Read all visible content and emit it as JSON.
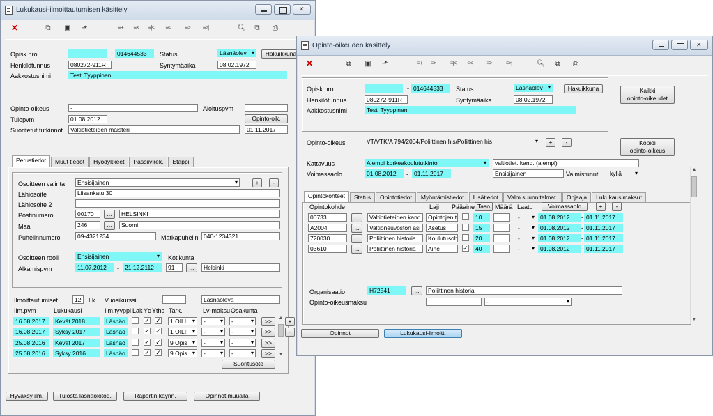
{
  "win1": {
    "title": "Lukukausi-ilmoittautumisen käsittely",
    "header": {
      "opiskno_label": "Opisk.nro",
      "opiskno_dash": "-",
      "opiskno_value": "014644533",
      "status_label": "Status",
      "status_value": "Läsnäolev",
      "hakuikkuna_button": "Hakuikkuna",
      "henkilotunnus_label": "Henkilötunnus",
      "henkilotunnus_value": "080272-911R",
      "syntymaaika_label": "Syntymäaika",
      "syntymaaika_value": "08.02.1972",
      "aakkostusnimi_label": "Aakkostusnimi",
      "aakkostusnimi_value": "Testi Tyyppinen"
    },
    "study": {
      "opinto_oikeus_label": "Opinto-oikeus",
      "opinto_oikeus_value": "-",
      "aloituspvm_label": "Aloituspvm",
      "tulopvm_label": "Tulopvm",
      "tulopvm_value": "01.08.2012",
      "opinto_oik_button": "Opinto-oik.",
      "suoritetut_label": "Suoritetut tutkinnot",
      "suoritetut_value": "Valtiotieteiden maisteri",
      "suoritetut_date": "01.11.2017"
    },
    "tabs": [
      "Perustiedot",
      "Muut tiedot",
      "Hyödykkeet",
      "Passiivirek.",
      "Etappi"
    ],
    "address": {
      "osoitteen_valinta_label": "Osoitteen valinta",
      "osoitteen_valinta_value": "Ensisijainen",
      "plus": "+",
      "minus": "-",
      "lahiosoite_label": "Lähiosoite",
      "lahiosoite_value": "Liisankatu 30",
      "lahiosoite2_label": "Lähiosoite 2",
      "postinumero_label": "Postinumero",
      "postinumero_value": "00170",
      "ellipsis": "...",
      "postitoimipaikka_value": "HELSINKI",
      "maa_label": "Maa",
      "maa_code": "246",
      "maa_name": "Suomi",
      "puhelin_label": "Puhelinnumero",
      "puhelin_value": "09-4321234",
      "matkapuhelin_label": "Matkapuhelin",
      "matkapuhelin_value": "040-1234321",
      "rooli_label": "Osoitteen rooli",
      "rooli_value": "Ensisijainen",
      "kotikunta_label": "Kotikunta",
      "alkamispvm_label": "Alkamispvm",
      "alkamis_from": "11.07.2012",
      "alkamis_dash": "-",
      "alkamis_to": "21.12.2112",
      "kotikunta_code": "91",
      "kotikunta_name": "Helsinki"
    },
    "ilmo": {
      "label": "Ilmoittautumiset",
      "count": "12",
      "lk": "Lk",
      "vuosikurssi_label": "Vuosikurssi",
      "status_text": "Läsnäoleva",
      "columns": [
        "Ilm.pvm",
        "Lukukausi",
        "Ilm.tyyppi",
        "Lak",
        "Yc",
        "Yths",
        "Tark.",
        "Lv-maksu",
        "Osakunta"
      ],
      "rows": [
        {
          "date": "16.08.2017",
          "term": "Kevät 2018",
          "type": "Läsnäo",
          "lak": false,
          "yc": true,
          "yths": true,
          "tark": "1 OILI:",
          "lv": "-",
          "osa": "-",
          "go": ">>"
        },
        {
          "date": "16.08.2017",
          "term": "Syksy 2017",
          "type": "Läsnäo",
          "lak": false,
          "yc": true,
          "yths": true,
          "tark": "1 OILI:",
          "lv": "-",
          "osa": "-",
          "go": ">>"
        },
        {
          "date": "25.08.2016",
          "term": "Kevät 2017",
          "type": "Läsnäo",
          "lak": false,
          "yc": true,
          "yths": true,
          "tark": "9 Opis",
          "lv": "-",
          "osa": "-",
          "go": ">>"
        },
        {
          "date": "25.08.2016",
          "term": "Syksy 2016",
          "type": "Läsnäo",
          "lak": false,
          "yc": true,
          "yths": true,
          "tark": "9 Opis",
          "lv": "-",
          "osa": "-",
          "go": ">>"
        }
      ],
      "suoritusote_button": "Suoritusote"
    },
    "bottom_buttons": [
      "Hyväksy ilm.",
      "Tulosta läsnäolotod.",
      "Raportin käynn.",
      "Opinnot muualla"
    ]
  },
  "win2": {
    "title": "Opinto-oikeuden käsittely",
    "header": {
      "opiskno_label": "Opisk.nro",
      "opiskno_dash": "-",
      "opiskno_value": "014644533",
      "status_label": "Status",
      "status_value": "Läsnäolev",
      "hakuikkuna_button": "Hakuikkuna",
      "henkilotunnus_label": "Henkilötunnus",
      "henkilotunnus_value": "080272-911R",
      "syntymaaika_label": "Syntymäaika",
      "syntymaaika_value": "08.02.1972",
      "aakkostusnimi_label": "Aakkostusnimi",
      "aakkostusnimi_value": "Testi Tyyppinen"
    },
    "kaikki_button_line1": "Kaikki",
    "kaikki_button_line2": "opinto-oikeudet",
    "kopioi_button_line1": "Kopioi",
    "kopioi_button_line2": "opinto-oikeus",
    "opinto_oikeus_label": "Opinto-oikeus",
    "opinto_oikeus_value": "VT/VTK/A 794/2004/Poliittinen his/Poliittinen his",
    "plus": "+",
    "minus": "-",
    "kattavuus_label": "Kattavuus",
    "kattavuus_value": "Alempi korkeakoulututkinto",
    "kattavuus_desc": "valtiotiet. kand. (alempi)",
    "voimassaolo_label": "Voimassaolo",
    "voimassa_from": "01.08.2012",
    "voimassa_dash": "-",
    "voimassa_to": "01.11.2017",
    "voimassa_type": "Ensisijainen",
    "valmistunut_label": "Valmistunut",
    "valmistunut_value": "kyllä",
    "tabs": [
      "Opintokohteet",
      "Status",
      "Opintotiedot",
      "Myöntämistiedot",
      "Lisätiedot",
      "Valm.suunnitelmat.",
      "Ohjaaja",
      "Lukukausimaksut"
    ],
    "columns": {
      "kohde": "Opintokohde",
      "laji": "Laji",
      "paaaine": "Pääaine",
      "taso": "Taso",
      "maara": "Määrä",
      "laatu": "Laatu"
    },
    "voimassaolo_button": "Voimassaolo",
    "rows": [
      {
        "code": "00733",
        "name": "Valtiotieteiden kand",
        "laji": "Opintojen t",
        "main": false,
        "taso": "10",
        "laatu": "-",
        "from": "01.08.2012",
        "to": "01.11.2017"
      },
      {
        "code": "A2004",
        "name": "Valtioneuvoston asi",
        "laji": "Asetus",
        "main": false,
        "taso": "15",
        "laatu": "-",
        "from": "01.08.2012",
        "to": "01.11.2017"
      },
      {
        "code": "720030",
        "name": "Poliittinen historia",
        "laji": "Koulutusoh",
        "main": false,
        "taso": "20",
        "laatu": "-",
        "from": "01.08.2012",
        "to": "01.11.2017"
      },
      {
        "code": "03610",
        "name": "Poliittinen historia",
        "laji": "Aine",
        "main": true,
        "taso": "40",
        "laatu": "-",
        "from": "01.08.2012",
        "to": "01.11.2017"
      }
    ],
    "organisaatio_label": "Organisaatio",
    "organisaatio_code": "H72541",
    "organisaatio_name": "Poliittinen historia",
    "maksu_label": "Opinto-oikeusmaksu",
    "maksu_value": "-",
    "opinnot_button": "Opinnot",
    "lukukausi_button": "Lukukausi-ilmoitt."
  }
}
